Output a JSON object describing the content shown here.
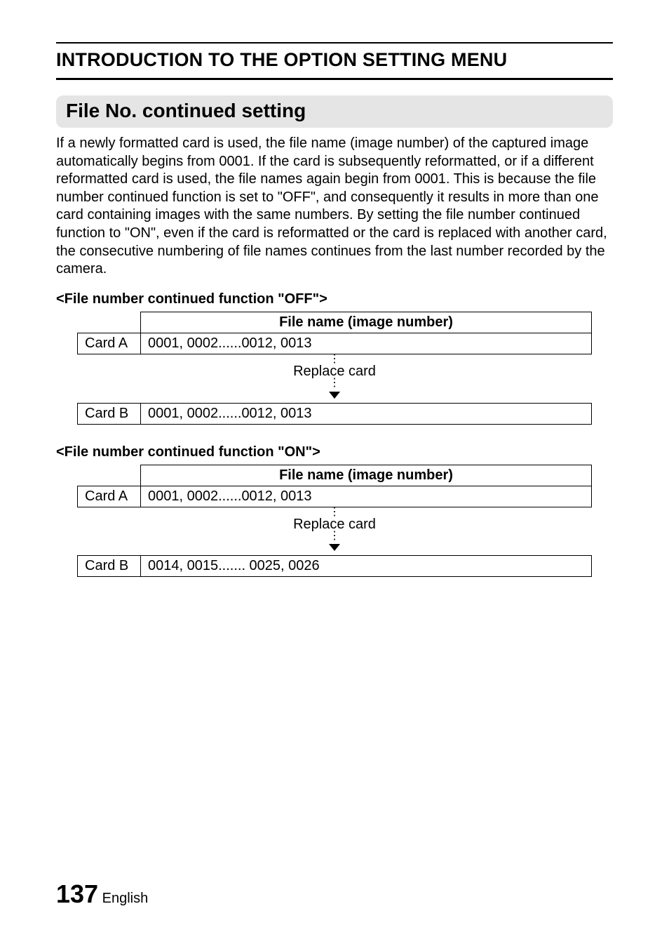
{
  "header": {
    "title": "INTRODUCTION TO THE OPTION SETTING MENU"
  },
  "section": {
    "pill_title": "File No. continued setting",
    "body": "If a newly formatted card is used, the file name (image number) of the captured image automatically begins from 0001. If the card is subsequently reformatted, or if a different reformatted card is used, the file names again begin from 0001. This is because the file number continued function is set to \"OFF\", and consequently it results in more than one card containing images with the same numbers. By setting the file number continued function to \"ON\", even if the card is reformatted or the card is replaced with another card, the consecutive numbering of file names continues from the last number recorded by the camera."
  },
  "example_off": {
    "heading": "<File number continued function \"OFF\">",
    "col_header": "File name (image number)",
    "row_a_label": "Card A",
    "row_a_value": "0001, 0002......0012, 0013",
    "replace_label": "Replace card",
    "row_b_label": "Card B",
    "row_b_value": "0001, 0002......0012, 0013"
  },
  "example_on": {
    "heading": "<File number continued function \"ON\">",
    "col_header": "File name (image number)",
    "row_a_label": "Card A",
    "row_a_value": "0001, 0002......0012, 0013",
    "replace_label": "Replace card",
    "row_b_label": "Card B",
    "row_b_value": "0014, 0015....... 0025, 0026"
  },
  "footer": {
    "page_number": "137",
    "language": "English"
  }
}
